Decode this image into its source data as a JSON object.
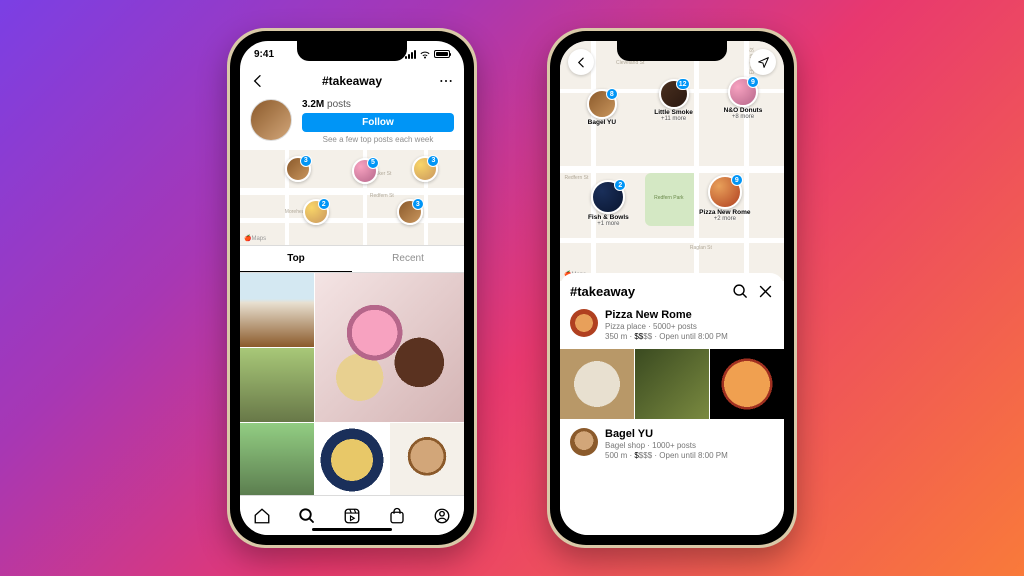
{
  "statusbar": {
    "time": "9:41"
  },
  "left": {
    "nav_title": "#takeaway",
    "post_count": "3.2M",
    "post_label": "posts",
    "follow_label": "Follow",
    "hint": "See a few top posts each week",
    "map_attr": "🍎Maps",
    "pins": [
      {
        "badge": "3"
      },
      {
        "badge": "5"
      },
      {
        "badge": "3"
      },
      {
        "badge": "2"
      },
      {
        "badge": "3"
      }
    ],
    "tabs": {
      "top": "Top",
      "recent": "Recent"
    }
  },
  "right": {
    "map_attr": "🍎Maps",
    "pins": [
      {
        "label": "Bagel YU",
        "badge": "8",
        "more": ""
      },
      {
        "label": "Little Smoke",
        "badge": "12",
        "more": "+11 more"
      },
      {
        "label": "N&O Donuts",
        "badge": "9",
        "more": "+8 more"
      },
      {
        "label": "Fish & Bowls",
        "badge": "2",
        "more": "+1 more"
      },
      {
        "label": "Pizza New Rome",
        "badge": "9",
        "more": "+2 more"
      }
    ],
    "sheet_title": "#takeaway",
    "places": [
      {
        "name": "Pizza New Rome",
        "category": "Pizza place",
        "posts": "5000+ posts",
        "distance": "350 m",
        "price_active": "$$",
        "price_inactive": "$$",
        "hours": "Open until 8:00 PM"
      },
      {
        "name": "Bagel YU",
        "category": "Bagel shop",
        "posts": "1000+ posts",
        "distance": "500 m",
        "price_active": "$",
        "price_inactive": "$$$",
        "hours": "Open until 8:00 PM"
      }
    ],
    "streets": {
      "cleveland": "Cleveland St",
      "elizabeth": "Elizabeth St",
      "redfern": "Redfern St",
      "raglan": "Raglan St",
      "park": "Redfern Park"
    }
  }
}
